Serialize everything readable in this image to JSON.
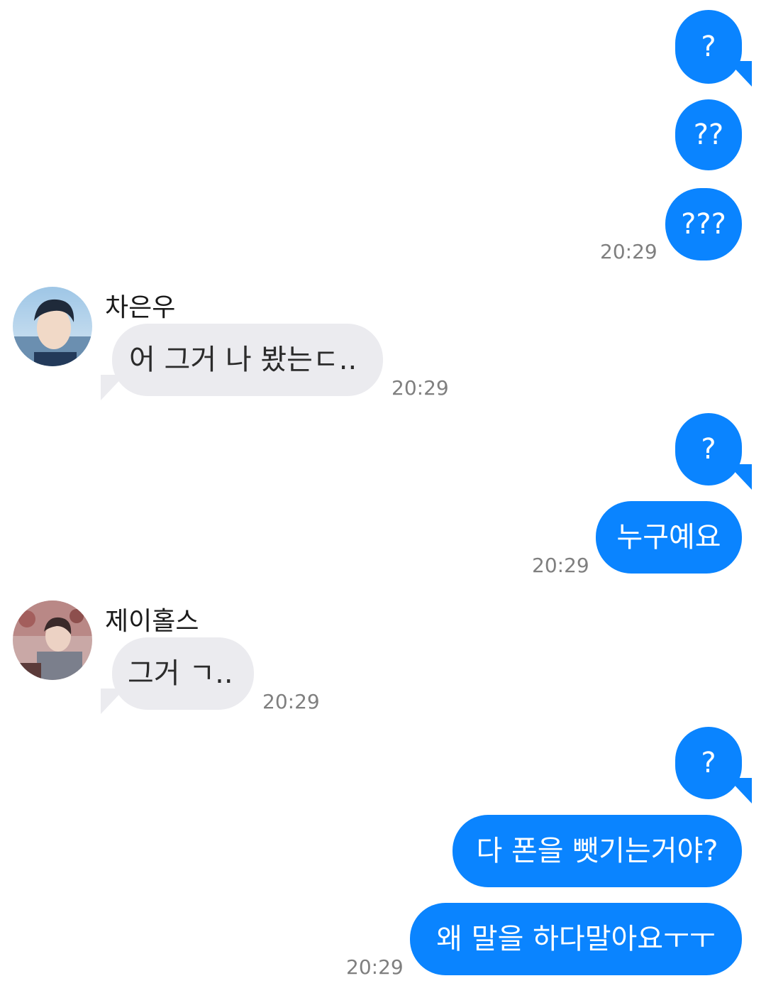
{
  "conversation": {
    "messages": [
      {
        "direction": "out",
        "text": "?"
      },
      {
        "direction": "out",
        "text": "??"
      },
      {
        "direction": "out",
        "text": "???",
        "time": "20:29"
      },
      {
        "direction": "in",
        "sender": "차은우",
        "avatar_icon": "profile-photo-avatar",
        "text": "어 그거 나 봤는ㄷ..",
        "time": "20:29"
      },
      {
        "direction": "out",
        "text": "?"
      },
      {
        "direction": "out",
        "text": "누구예요",
        "time": "20:29"
      },
      {
        "direction": "in",
        "sender": "제이홀스",
        "avatar_icon": "profile-photo-avatar",
        "text": "그거 ㄱ..",
        "time": "20:29"
      },
      {
        "direction": "out",
        "text": "?"
      },
      {
        "direction": "out",
        "text": "다 폰을 뺏기는거야?"
      },
      {
        "direction": "out",
        "text": "왜 말을 하다말아요ㅜㅜ",
        "time": "20:29"
      }
    ]
  },
  "colors": {
    "outgoing_bubble": "#0a84ff",
    "incoming_bubble": "#ebebef",
    "timestamp": "#7f7f7f"
  }
}
